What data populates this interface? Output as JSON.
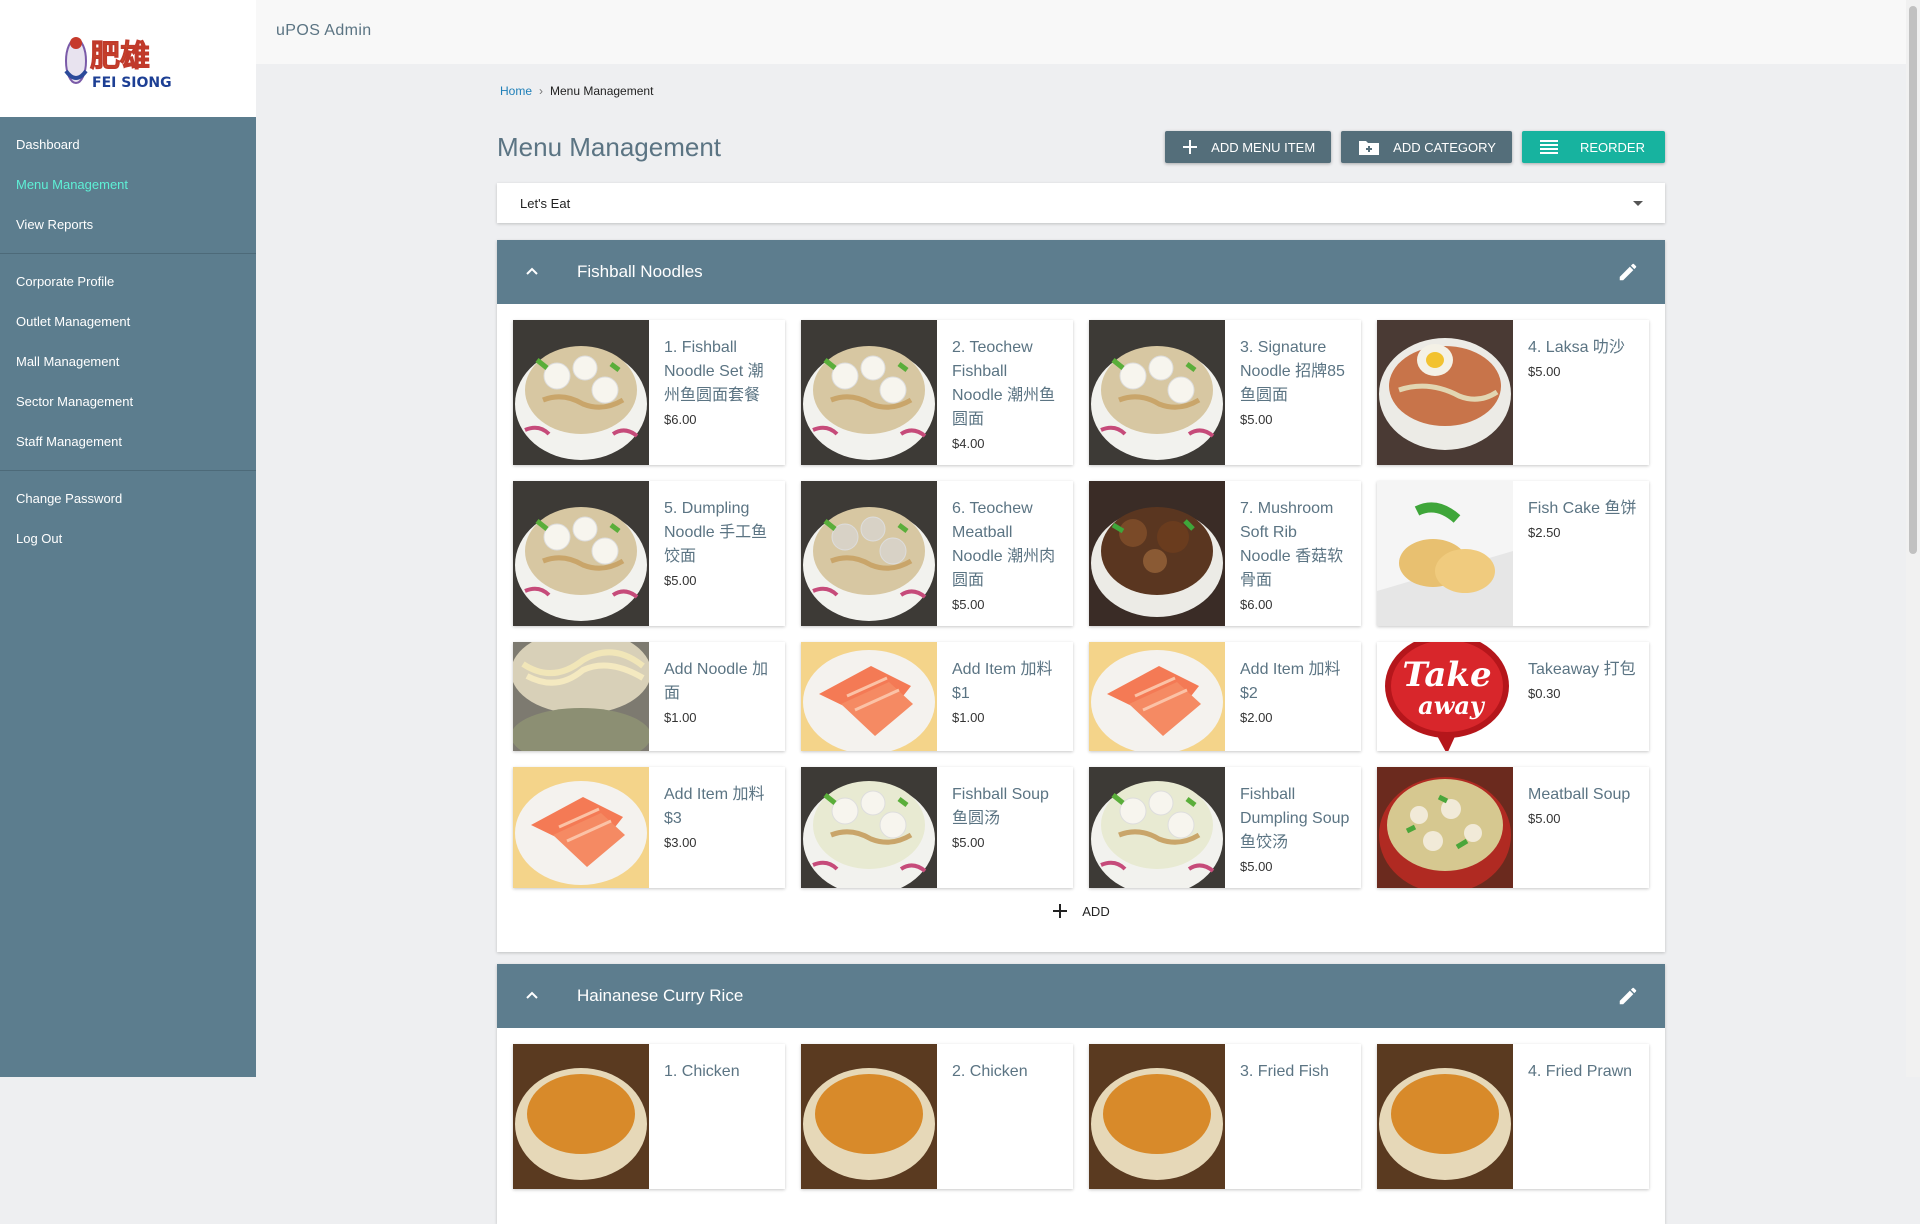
{
  "app": {
    "title": "uPOS Admin"
  },
  "brand": {
    "logo_chinese": "肥雄",
    "logo_english": "FEI SIONG"
  },
  "sidebar": {
    "items": [
      {
        "label": "Dashboard"
      },
      {
        "label": "Menu Management",
        "active": true
      },
      {
        "label": "View Reports"
      },
      {
        "label": "Corporate Profile"
      },
      {
        "label": "Outlet Management"
      },
      {
        "label": "Mall Management"
      },
      {
        "label": "Sector Management"
      },
      {
        "label": "Staff Management"
      },
      {
        "label": "Change Password"
      },
      {
        "label": "Log Out"
      }
    ]
  },
  "breadcrumb": {
    "home": "Home",
    "current": "Menu Management"
  },
  "page": {
    "title": "Menu Management"
  },
  "actions": {
    "add_menu_item": "ADD MENU ITEM",
    "add_category": "ADD CATEGORY",
    "reorder": "REORDER"
  },
  "menu_select": {
    "value": "Let's Eat"
  },
  "categories": [
    {
      "name": "Fishball Noodles",
      "add_label": "ADD",
      "items": [
        {
          "name": "1. Fishball Noodle Set 潮州鱼圆面套餐",
          "price": "$6.00",
          "image": "noodle-bowl"
        },
        {
          "name": "2. Teochew Fishball Noodle 潮州鱼圆面",
          "price": "$4.00",
          "image": "noodle-bowl"
        },
        {
          "name": "3. Signature Noodle 招牌85鱼圆面",
          "price": "$5.00",
          "image": "noodle-bowl"
        },
        {
          "name": "4. Laksa 叻沙",
          "price": "$5.00",
          "image": "laksa-bowl"
        },
        {
          "name": "5. Dumpling Noodle 手工鱼饺面",
          "price": "$5.00",
          "image": "dumpling-bowl"
        },
        {
          "name": "6. Teochew Meatball Noodle 潮州肉圆面",
          "price": "$5.00",
          "image": "meatball-bowl"
        },
        {
          "name": "7. Mushroom Soft Rib Noodle 香菇软骨面",
          "price": "$6.00",
          "image": "rib-noodle"
        },
        {
          "name": "Fish Cake 鱼饼",
          "price": "$2.50",
          "image": "fish-cake"
        },
        {
          "name": "Add Noodle 加面",
          "price": "$1.00",
          "image": "noodle-pot"
        },
        {
          "name": "Add Item 加料 $1",
          "price": "$1.00",
          "image": "salmon"
        },
        {
          "name": "Add Item 加料 $2",
          "price": "$2.00",
          "image": "salmon"
        },
        {
          "name": "Takeaway 打包",
          "price": "$0.30",
          "image": "takeaway-badge"
        },
        {
          "name": "Add Item 加料 $3",
          "price": "$3.00",
          "image": "salmon"
        },
        {
          "name": "Fishball Soup 鱼圆汤",
          "price": "$5.00",
          "image": "fishball-soup"
        },
        {
          "name": "Fishball Dumpling Soup 鱼饺汤",
          "price": "$5.00",
          "image": "dumpling-soup"
        },
        {
          "name": "Meatball Soup",
          "price": "$5.00",
          "image": "meatball-soup"
        }
      ]
    },
    {
      "name": "Hainanese Curry Rice",
      "items": [
        {
          "name": "1. Chicken",
          "price": "",
          "image": "curry-rice"
        },
        {
          "name": "2. Chicken",
          "price": "",
          "image": "curry-rice"
        },
        {
          "name": "3. Fried Fish",
          "price": "",
          "image": "curry-rice"
        },
        {
          "name": "4. Fried Prawn",
          "price": "",
          "image": "curry-rice"
        }
      ]
    }
  ],
  "takeaway_badge": {
    "line1": "Take",
    "line2": "away"
  },
  "colors": {
    "sidebar": "#5c7d8e",
    "header": "#5d7d8e",
    "accent": "#17b39f",
    "active_nav": "#5ef0d6",
    "title": "#5b7483"
  }
}
